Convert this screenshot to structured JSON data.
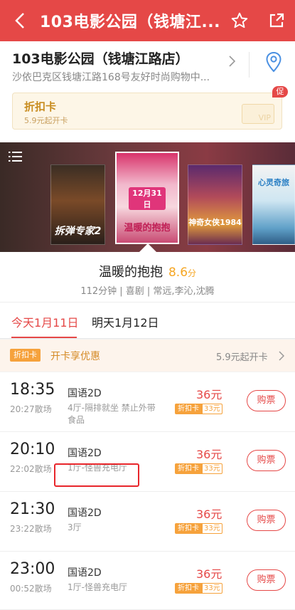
{
  "header": {
    "title": "103电影公园（钱塘江...",
    "icons": [
      "back-arrow-icon",
      "star-icon",
      "share-icon"
    ]
  },
  "cinema": {
    "name": "103电影公园（钱塘江路店）",
    "address": "沙依巴克区钱塘江路168号友好时尚购物中...",
    "card_title": "折扣卡",
    "card_subtitle": "5.9元起开卡",
    "promo_badge": "促",
    "vip_label": "VIP"
  },
  "posters": [
    {
      "title": "拆弹专家2"
    },
    {
      "title": "温暖的抱抱",
      "date_text": "12月31日"
    },
    {
      "title": "神奇女侠1984"
    },
    {
      "title": "心灵奇旅"
    }
  ],
  "movie": {
    "title": "温暖的抱抱",
    "score": "8.6",
    "score_unit": "分",
    "meta": "112分钟 | 喜剧 | 常远,李沁,沈腾"
  },
  "tabs": [
    {
      "label": "今天1月11日",
      "active": true
    },
    {
      "label": "明天1月12日",
      "active": false
    }
  ],
  "promo_row": {
    "tag": "折扣卡",
    "text": "开卡享优惠",
    "price": "5.9元起开卡"
  },
  "showtimes": [
    {
      "time": "18:35",
      "end": "20:27散场",
      "lang": "国语2D",
      "hall": "4厅-隔排就坐 禁止外带食品",
      "price": "36元",
      "card_label": "折扣卡",
      "card_price": "33元",
      "buy": "购票"
    },
    {
      "time": "20:10",
      "end": "22:02散场",
      "lang": "国语2D",
      "hall": "1厅-怪兽充电厅",
      "price": "36元",
      "card_label": "折扣卡",
      "card_price": "33元",
      "buy": "购票"
    },
    {
      "time": "21:30",
      "end": "23:22散场",
      "lang": "国语2D",
      "hall": "3厅",
      "price": "36元",
      "card_label": "折扣卡",
      "card_price": "33元",
      "buy": "购票"
    },
    {
      "time": "23:00",
      "end": "00:52散场",
      "lang": "国语2D",
      "hall": "1厅-怪兽充电厅",
      "price": "36元",
      "card_label": "折扣卡",
      "card_price": "33元",
      "buy": "购票"
    }
  ],
  "colors": {
    "brand": "#e54847",
    "score": "#f5a623",
    "card": "#f6a23c"
  }
}
